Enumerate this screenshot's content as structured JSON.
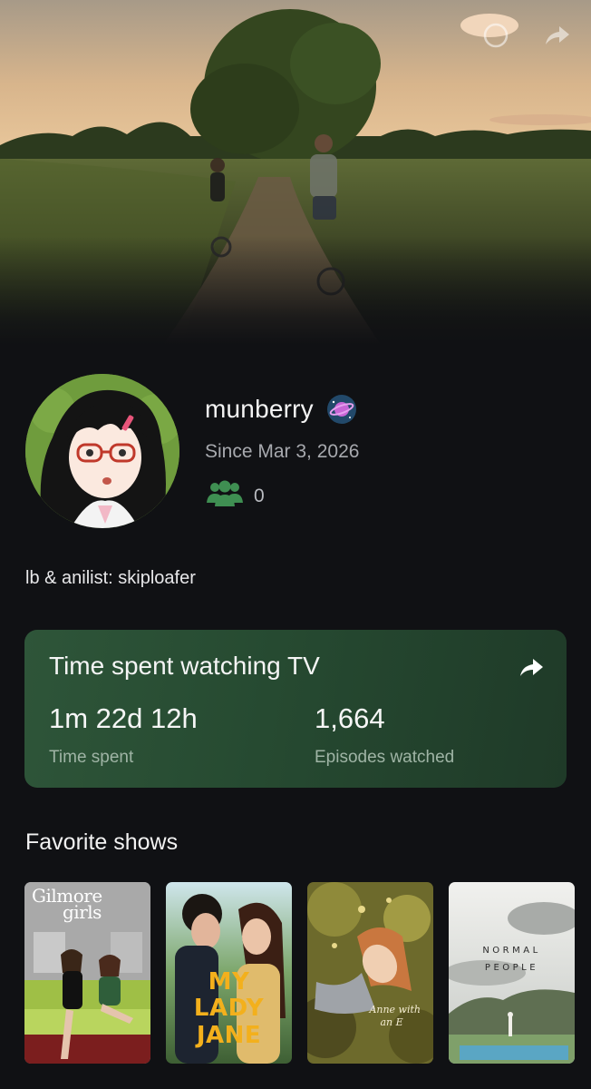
{
  "profile": {
    "username": "munberry",
    "since": "Since Mar 3, 2026",
    "followers_count": "0",
    "bio": "lb & anilist: skiploafer"
  },
  "stats": {
    "title": "Time spent watching TV",
    "time_spent_value": "1m 22d 12h",
    "time_spent_label": "Time spent",
    "episodes_value": "1,664",
    "episodes_label": "Episodes watched"
  },
  "favorites": {
    "title": "Favorite shows",
    "shows": [
      {
        "title_line1": "Gilmore",
        "title_line2": "girls"
      },
      {
        "title_line1": "MY",
        "title_line2": "LADY",
        "title_line3": "JANE"
      },
      {
        "title_line1": "Anne with",
        "title_line2": "an E"
      },
      {
        "title_line1": "NORMAL",
        "title_line2": "PEOPLE"
      }
    ]
  },
  "icons": {
    "top_left": "settings-icon",
    "top_right": "share-icon",
    "badge": "planet-icon",
    "followers": "users-icon",
    "card_share": "share-arrow-icon"
  },
  "colors": {
    "background": "#101114",
    "card": "#2b5136",
    "accent_green": "#3f8f52",
    "muted_text": "#a7a9ae"
  }
}
